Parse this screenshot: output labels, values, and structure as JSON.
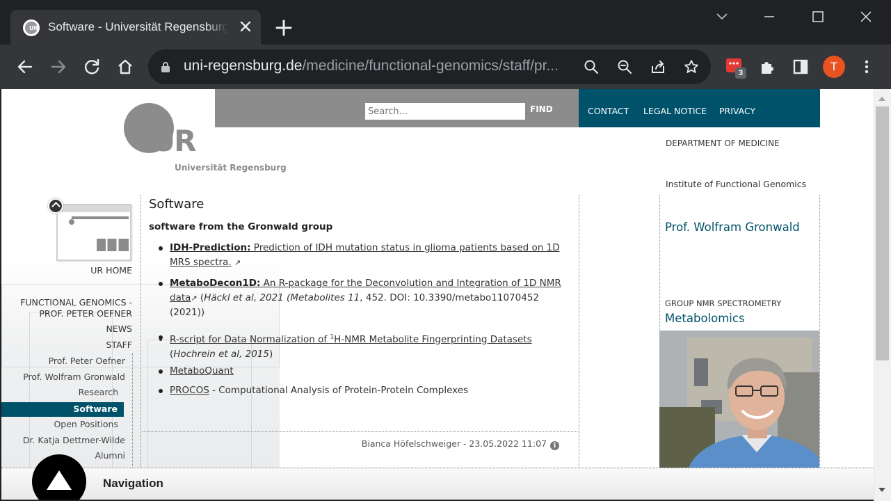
{
  "browser": {
    "tab_title": "Software - Universität Regensburg",
    "url_host": "uni-regensburg.de",
    "url_path": "/medicine/functional-genomics/staff/pr...",
    "extension_badge": "3",
    "profile_initial": "T"
  },
  "header": {
    "search_placeholder": "Search...",
    "find_label": "FIND",
    "meta_nav": [
      "CONTACT",
      "LEGAL NOTICE",
      "PRIVACY"
    ],
    "logo_text": "UR",
    "logo_name": "Universität Regensburg",
    "department": "DEPARTMENT OF MEDICINE",
    "institute": "Institute of Functional Genomics"
  },
  "left_nav": {
    "home_label": "UR HOME",
    "items": [
      {
        "label_line1": "FUNCTIONAL GENOMICS -",
        "label_line2": "PROF. PETER OEFNER"
      },
      {
        "label": "NEWS"
      },
      {
        "label": "STAFF"
      },
      {
        "label": "Prof. Peter Oefner"
      },
      {
        "label": "Prof. Wolfram Gronwald"
      },
      {
        "label": "Research"
      },
      {
        "label": "Software",
        "active": true
      },
      {
        "label": "Open Positions"
      },
      {
        "label": "Dr. Katja Dettmer-Wilde"
      },
      {
        "label": "Alumni"
      }
    ]
  },
  "main": {
    "title": "Software",
    "lead": "software from the Gronwald group",
    "items": [
      {
        "bold_link": "IDH-Prediction:",
        "link_line1": " Prediction of IDH mutation status in glioma patients based on 1D",
        "link_line2": "MRS spectra.",
        "arrow": "↗"
      },
      {
        "bold_link": "MetaboDecon1D:",
        "link_line1": " An R-package for the Deconvolution and Integration of 1D NMR",
        "link_line2": "data",
        "arrow": "↗",
        "citation_open": " (",
        "citation_authors": "Häckl et al, 2021 (Metabolites 11",
        "citation_rest": ", 452. DOI: 10.3390/metabo11070452",
        "citation_line3": "(2021))"
      },
      {
        "link_pre": "R-script for Data Normalization of ",
        "sup": "1",
        "link_post": "H-NMR Metabolite Fingerprinting Datasets",
        "citation_open": "(",
        "citation_authors": "Hochrein et al, 2015",
        "citation_close": ")"
      },
      {
        "link": "MetaboQuant"
      },
      {
        "link": "PROCOS",
        "rest": " - Computational Analysis of Protein-Protein Complexes"
      }
    ],
    "footer": "Bianca Höfelschweiger - 23.05.2022 11:07",
    "info_glyph": "i"
  },
  "right": {
    "prof_link": "Prof. Wolfram Gronwald",
    "group_label": "GROUP NMR SPECTROMETRY",
    "group_link": "Metabolomics"
  },
  "navbar": {
    "title": "Navigation"
  },
  "colors": {
    "accent": "#00526a",
    "header_gray": "#8c8c8c",
    "chrome_dark": "#202124",
    "chrome_toolbar": "#35363a",
    "avatar": "#e8531f"
  },
  "icons": [
    "back-icon",
    "forward-icon",
    "reload-icon",
    "home-icon",
    "lock-icon",
    "search-icon",
    "zoom-out-icon",
    "share-icon",
    "star-icon",
    "extension-icon",
    "puzzle-icon",
    "sidepanel-icon",
    "menu-icon",
    "close-icon",
    "plus-icon",
    "chevron-down-icon",
    "minimize-icon",
    "maximize-icon",
    "info-icon"
  ]
}
